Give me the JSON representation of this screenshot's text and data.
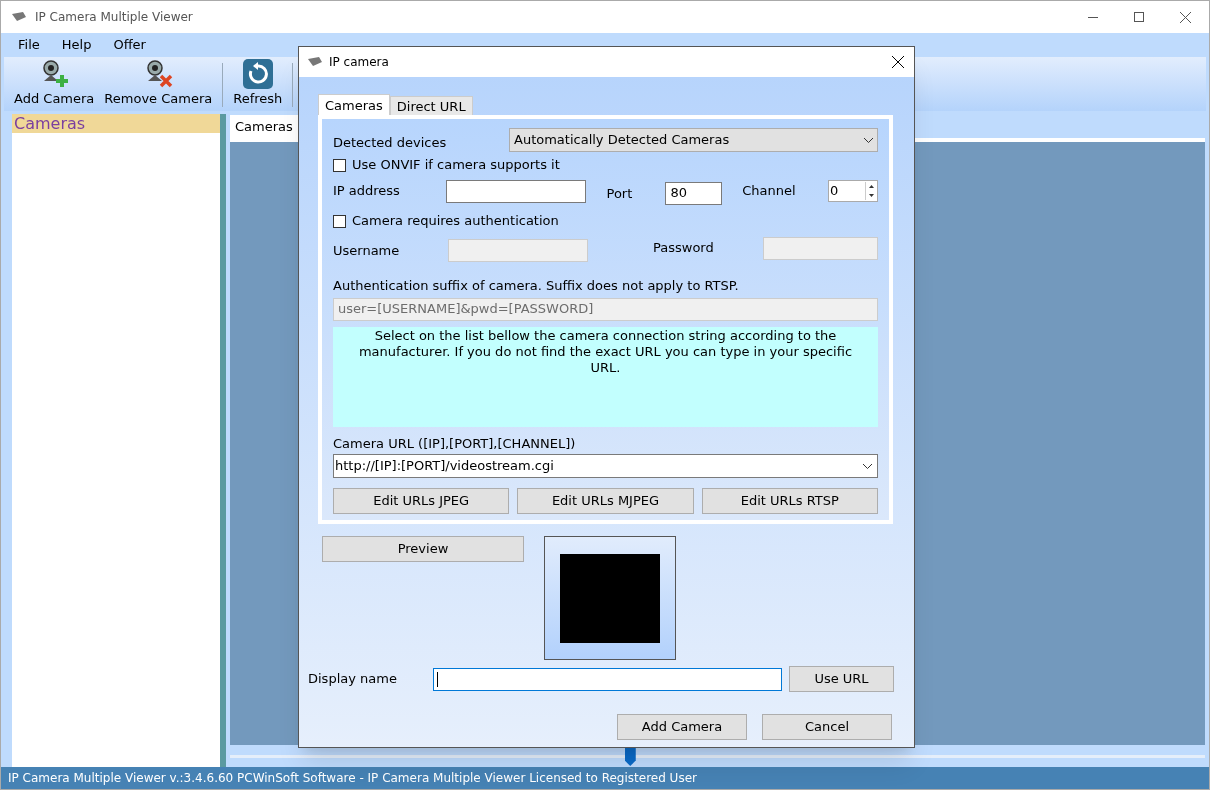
{
  "window": {
    "title": "IP Camera Multiple Viewer"
  },
  "menu": [
    "File",
    "Help",
    "Offer"
  ],
  "toolbar": [
    {
      "label": "Add Camera",
      "kind": "add"
    },
    {
      "label": "Remove Camera",
      "kind": "remove"
    },
    {
      "label": "Refresh",
      "kind": "refresh"
    }
  ],
  "sidebar": {
    "title": "Cameras"
  },
  "tabs": [
    {
      "label": "Cameras",
      "selected": true
    }
  ],
  "slider": {
    "level": 0.41
  },
  "status_bar": "IP Camera Multiple Viewer v.:3.4.6.60 PCWinSoft Software - IP Camera Multiple Viewer Licensed to Registered User",
  "dialog": {
    "title": "IP camera",
    "tabs": [
      {
        "label": "Cameras",
        "selected": true
      },
      {
        "label": "Direct URL",
        "selected": false
      }
    ],
    "detected_label": "Detected devices",
    "detected_value": "Automatically Detected Cameras",
    "onvif": {
      "label": "Use ONVIF if camera supports it",
      "checked": false
    },
    "ip_label": "IP address",
    "port_label": "Port",
    "port_value": "80",
    "channel_label": "Channel",
    "channel_value": "0",
    "auth": {
      "label": "Camera requires authentication",
      "checked": false
    },
    "username_label": "Username",
    "username_disabled": true,
    "password_label": "Password",
    "password_disabled": true,
    "suffix_label": "Authentication suffix of camera. Suffix does not apply to RTSP.",
    "suffix_value": "user=[USERNAME]&pwd=[PASSWORD]",
    "suffix_disabled": true,
    "info_text": "Select on the list bellow the camera connection string according to the manufacturer. If you do not find the exact URL you can type in your specific URL.",
    "url_label": "Camera URL ([IP],[PORT],[CHANNEL])",
    "url_value": "http://[IP]:[PORT]/videostream.cgi",
    "edit_buttons": [
      "Edit URLs JPEG",
      "Edit URLs MJPEG",
      "Edit URLs RTSP"
    ],
    "preview_button": "Preview",
    "display_name_label": "Display name",
    "use_url_button": "Use URL",
    "buttons": [
      "Add Camera",
      "Cancel"
    ]
  }
}
